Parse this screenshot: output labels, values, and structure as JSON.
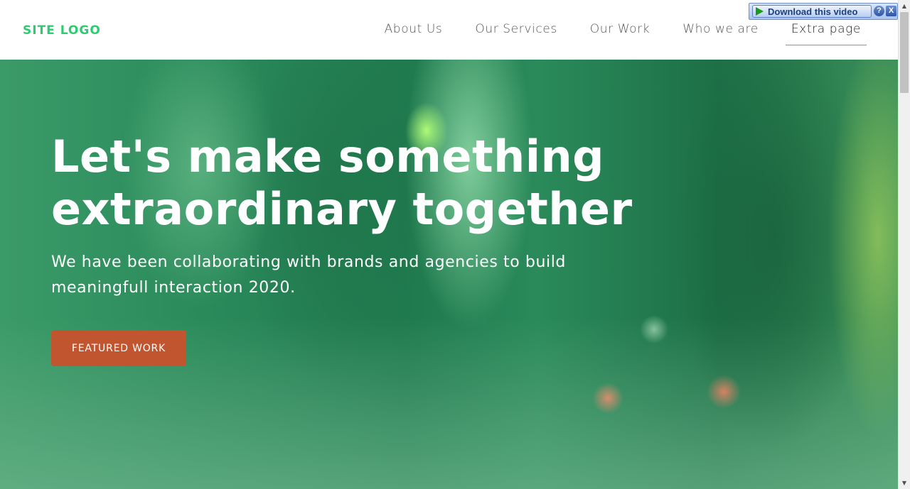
{
  "header": {
    "logo": "SITE LOGO",
    "nav": [
      {
        "label": "About Us",
        "active": false
      },
      {
        "label": "Our Services",
        "active": false
      },
      {
        "label": "Our Work",
        "active": false
      },
      {
        "label": "Who we are",
        "active": false
      },
      {
        "label": "Extra page",
        "active": true
      }
    ]
  },
  "hero": {
    "title": "Let's make something extraordinary together",
    "subtitle": "We have been collaborating with brands and agencies to build meaningfull interaction 2020.",
    "cta_label": "FEATURED WORK"
  },
  "download_bar": {
    "label": "Download this video",
    "help_glyph": "?",
    "close_glyph": "X"
  },
  "scrollbar": {
    "up_glyph": "▲",
    "down_glyph": "▼"
  },
  "colors": {
    "accent": "#2ecc71",
    "cta": "#c0552f",
    "hero_overlay": "#2a8a5a"
  }
}
